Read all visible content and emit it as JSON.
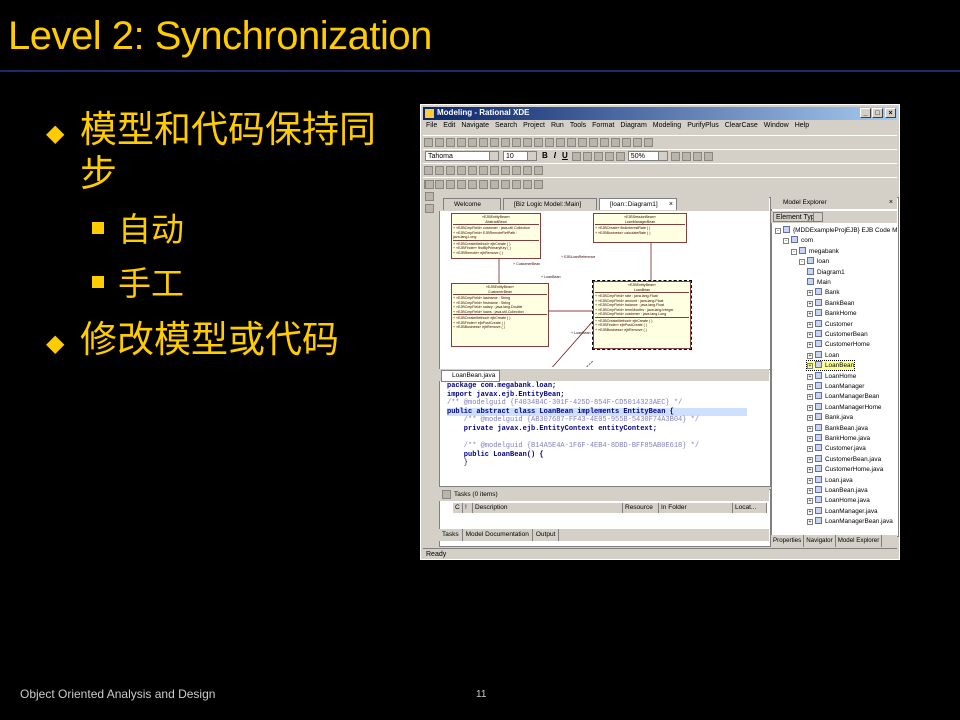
{
  "slide": {
    "title": "Level 2: Synchronization",
    "bullets": [
      {
        "text": "模型和代码保持同步",
        "marker": "diamond",
        "sub": [
          {
            "text": "自动",
            "marker": "square"
          },
          {
            "text": "手工",
            "marker": "square"
          }
        ]
      },
      {
        "text": "修改模型或代码",
        "marker": "diamond"
      }
    ],
    "footer": "Object Oriented Analysis and Design",
    "page_number": "11",
    "colors": {
      "background": "#000000",
      "text": "#ffcc00",
      "rule": "#1b2a6b"
    }
  },
  "window": {
    "title": "Modeling - Rational XDE",
    "menu": [
      "File",
      "Edit",
      "Navigate",
      "Search",
      "Project",
      "Run",
      "Tools",
      "Format",
      "Diagram",
      "Modeling",
      "PurifyPlus",
      "ClearCase",
      "Window",
      "Help"
    ],
    "font_combo": "Tahoma",
    "size_combo": "10",
    "zoom_combo": "50%",
    "format_buttons": [
      "B",
      "I",
      "U"
    ],
    "doc_tabs": [
      "Welcome",
      "[Biz Logic Model::Main]",
      "[loan::Diagram1]"
    ],
    "uml": {
      "boxes": [
        {
          "stereo": "«EJBEntityBean»",
          "name": "AbstractBean",
          "attrs": [
            "+ «EJBCmpField» customer : java.util.Collection",
            "+ «EJBCmpField» EJBRemoteRefPath : java.lang.Long"
          ],
          "ops": [
            "+ «EJBCreateMethod» ejbCreate ( )",
            "+ «EJBFinder» findByPrimaryKey ( )",
            "+ «EJBRemote» ejbRemove ( )"
          ]
        },
        {
          "stereo": "«EJBSessionBean»",
          "name": "LoanManagerBean",
          "attrs": [],
          "ops": [
            "+ «EJBCreate» findInterestRate ( )",
            "+ «EJBBusiness» calculateRate ( )"
          ]
        },
        {
          "stereo": "«EJBEntityBean»",
          "name": "CustomerBean",
          "attrs": [
            "+ «EJBCmpField» lastname : String",
            "+ «EJBCmpField» firstname : String",
            "+ «EJBCmpField» salary : java.lang.Double",
            "+ «EJBCmpField» loans : java.util.Collection"
          ],
          "ops": [
            "+ «EJBCreateMethod» ejbCreate ( )",
            "+ «EJBFinder» ejbPostCreate ( )",
            "+ «EJBBusiness» ejbRemove ( )"
          ]
        },
        {
          "stereo": "«EJBEntityBean»",
          "name": "LoanBean",
          "attrs": [
            "+ «EJBCmpField» rate : java.lang.Float",
            "+ «EJBCmpField» amount : java.lang.Float",
            "+ «EJBCmpField» balance : java.lang.Float",
            "+ «EJBCmpField» termMonths : java.lang.Integer",
            "+ «EJBCmpField» customer : java.lang.Long"
          ],
          "ops": [
            "+ «EJBCreateMethod» ejbCreate ( )",
            "+ «EJBFinder» ejbPostCreate ( )",
            "+ «EJBBusiness» ejbRemove ( )"
          ]
        }
      ],
      "assoc_labels": [
        "+ CustomerBean",
        "+ LoanBean",
        "+ EJBLoanReference",
        "+ LoanBean"
      ]
    },
    "code_tab": "LoanBean.java",
    "code_lines": [
      {
        "kind": "kw",
        "text": "package com.megabank.loan;"
      },
      {
        "kind": "kw",
        "text": "import javax.ejb.EntityBean;"
      },
      {
        "kind": "cm",
        "text": "/** @modelguid {F4034B4C-301F-425D-854F-CD5014323AEC} */"
      },
      {
        "kind": "hl",
        "text": "public abstract class LoanBean implements EntityBean {"
      },
      {
        "kind": "cm",
        "text": "    /** @modelguid {AB307687-FF43-4E05-955B-5430F74A3B04} */"
      },
      {
        "kind": "kw",
        "text": "    private javax.ejb.EntityContext entityContext;"
      },
      {
        "kind": "plain",
        "text": ""
      },
      {
        "kind": "cm",
        "text": "    /** @modelguid {B14A5E4A-1F6F-4EB4-8DBD-BFF85AB0E618} */"
      },
      {
        "kind": "kw",
        "text": "    public LoanBean() {"
      },
      {
        "kind": "plain",
        "text": "    }"
      }
    ],
    "tasks": {
      "title": "Tasks (0 items)",
      "columns": [
        "C",
        "!",
        "Description",
        "Resource",
        "In Folder",
        "Locat..."
      ],
      "tabs": [
        "Tasks",
        "Model Documentation",
        "Output"
      ]
    },
    "explorer": {
      "title": "Model Explorer",
      "filter": "Element Type",
      "items": [
        {
          "text": "{MDDExampleProjEJB} EJB Code M",
          "depth": 0,
          "pm": "-"
        },
        {
          "text": "com",
          "depth": 1,
          "pm": "-"
        },
        {
          "text": "megabank",
          "depth": 2,
          "pm": "-"
        },
        {
          "text": "loan",
          "depth": 3,
          "pm": "-"
        },
        {
          "text": "Diagram1",
          "depth": 4,
          "pm": ""
        },
        {
          "text": "Main",
          "depth": 4,
          "pm": ""
        },
        {
          "text": "Bank",
          "depth": 4,
          "pm": "+"
        },
        {
          "text": "BankBean",
          "depth": 4,
          "pm": "+"
        },
        {
          "text": "BankHome",
          "depth": 4,
          "pm": "+"
        },
        {
          "text": "Customer",
          "depth": 4,
          "pm": "+"
        },
        {
          "text": "CustomerBean",
          "depth": 4,
          "pm": "+"
        },
        {
          "text": "CustomerHome",
          "depth": 4,
          "pm": "+"
        },
        {
          "text": "Loan",
          "depth": 4,
          "pm": "+"
        },
        {
          "text": "LoanBean",
          "depth": 4,
          "pm": "+",
          "selected": true
        },
        {
          "text": "LoanHome",
          "depth": 4,
          "pm": "+"
        },
        {
          "text": "LoanManager",
          "depth": 4,
          "pm": "+"
        },
        {
          "text": "LoanManagerBean",
          "depth": 4,
          "pm": "+"
        },
        {
          "text": "LoanManagerHome",
          "depth": 4,
          "pm": "+"
        },
        {
          "text": "Bank.java",
          "depth": 4,
          "pm": "+"
        },
        {
          "text": "BankBean.java",
          "depth": 4,
          "pm": "+"
        },
        {
          "text": "BankHome.java",
          "depth": 4,
          "pm": "+"
        },
        {
          "text": "Customer.java",
          "depth": 4,
          "pm": "+"
        },
        {
          "text": "CustomerBean.java",
          "depth": 4,
          "pm": "+"
        },
        {
          "text": "CustomerHome.java",
          "depth": 4,
          "pm": "+"
        },
        {
          "text": "Loan.java",
          "depth": 4,
          "pm": "+"
        },
        {
          "text": "LoanBean.java",
          "depth": 4,
          "pm": "+"
        },
        {
          "text": "LoanHome.java",
          "depth": 4,
          "pm": "+"
        },
        {
          "text": "LoanManager.java",
          "depth": 4,
          "pm": "+"
        },
        {
          "text": "LoanManagerBean.java",
          "depth": 4,
          "pm": "+"
        }
      ],
      "tabs": [
        "Properties",
        "Navigator",
        "Model Explorer"
      ]
    },
    "status": "Ready"
  }
}
